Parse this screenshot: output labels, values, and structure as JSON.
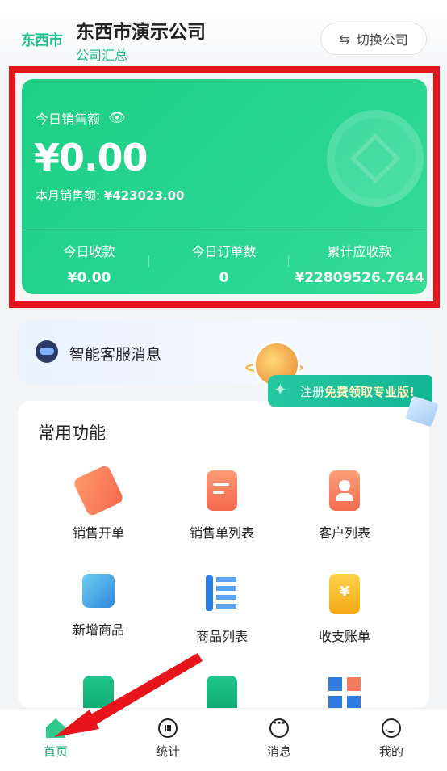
{
  "header": {
    "logo_text": "东西市",
    "company_name": "东西市演示公司",
    "company_sub": "公司汇总",
    "switch_label": "切换公司"
  },
  "sales_card": {
    "today_label": "今日销售额",
    "today_value": "¥0.00",
    "month_label": "本月销售额:",
    "month_value": "¥423023.00",
    "stats": [
      {
        "label": "今日收款",
        "value": "¥0.00"
      },
      {
        "label": "今日订单数",
        "value": "0"
      },
      {
        "label": "累计应收款",
        "value": "¥22809526.7644"
      }
    ]
  },
  "service": {
    "label": "智能客服消息",
    "promo_prefix": "注册",
    "promo_bold": "免费领取专业版!"
  },
  "functions": {
    "title": "常用功能",
    "items": [
      {
        "label": "销售开单",
        "icon": "price-tag-icon"
      },
      {
        "label": "销售单列表",
        "icon": "document-list-icon"
      },
      {
        "label": "客户列表",
        "icon": "customer-card-icon"
      },
      {
        "label": "新增商品",
        "icon": "add-product-cube-icon"
      },
      {
        "label": "商品列表",
        "icon": "product-list-icon"
      },
      {
        "label": "收支账单",
        "icon": "money-bag-icon"
      },
      {
        "label": "",
        "icon": "clipboard-check-icon"
      },
      {
        "label": "",
        "icon": "clipboard-list-icon"
      },
      {
        "label": "",
        "icon": "apps-grid-icon"
      }
    ]
  },
  "tabbar": {
    "items": [
      {
        "label": "首页",
        "icon": "home-icon",
        "active": true
      },
      {
        "label": "统计",
        "icon": "statistics-icon",
        "active": false
      },
      {
        "label": "消息",
        "icon": "message-icon",
        "active": false
      },
      {
        "label": "我的",
        "icon": "profile-icon",
        "active": false
      }
    ]
  },
  "colors": {
    "brand_green": "#1fcf84",
    "highlight_red": "#e8141c",
    "annotation_arrow": "#e8141c"
  }
}
